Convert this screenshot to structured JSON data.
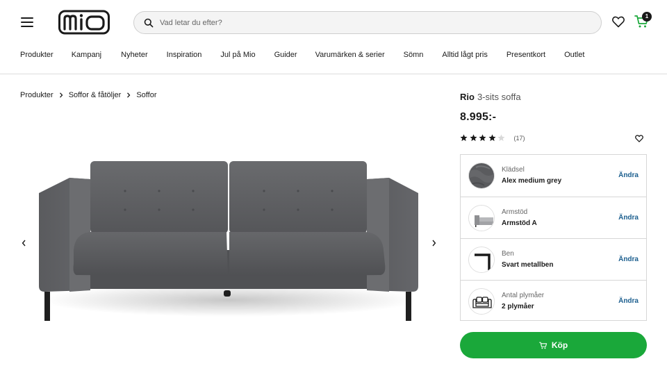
{
  "header": {
    "menu_icon": "hamburger-menu-icon",
    "logo_text": "mio",
    "search": {
      "placeholder": "Vad letar du efter?",
      "value": "",
      "icon": "search-icon"
    },
    "wishlist_icon": "heart-icon",
    "cart": {
      "icon": "cart-icon",
      "count": "1",
      "accent": "#1aa83a"
    }
  },
  "nav": {
    "items": [
      {
        "label": "Produkter"
      },
      {
        "label": "Kampanj"
      },
      {
        "label": "Nyheter"
      },
      {
        "label": "Inspiration"
      },
      {
        "label": "Jul på Mio"
      },
      {
        "label": "Guider"
      },
      {
        "label": "Varumärken & serier"
      },
      {
        "label": "Sömn"
      },
      {
        "label": "Alltid lågt pris"
      },
      {
        "label": "Presentkort"
      },
      {
        "label": "Outlet"
      }
    ]
  },
  "breadcrumb": {
    "items": [
      {
        "label": "Produkter"
      },
      {
        "label": "Soffor & fåtöljer"
      },
      {
        "label": "Soffor"
      }
    ]
  },
  "gallery": {
    "image": "grey-three-seat-sofa",
    "prev_icon": "chevron-left-icon",
    "next_icon": "chevron-right-icon",
    "sofa_color": "#5c5d60"
  },
  "product": {
    "name": "Rio",
    "subtitle": "3-sits soffa",
    "price": "8.995:-",
    "rating": {
      "stars": 4,
      "max": 5,
      "count_text": "(17)"
    },
    "favorite_icon": "heart-icon"
  },
  "options": [
    {
      "label": "Klädsel",
      "value": "Alex medium grey",
      "action": "Ändra",
      "thumb": "fabric-swatch"
    },
    {
      "label": "Armstöd",
      "value": "Armstöd A",
      "action": "Ändra",
      "thumb": "armrest-thumbnail"
    },
    {
      "label": "Ben",
      "value": "Svart metallben",
      "action": "Ändra",
      "thumb": "leg-thumbnail"
    },
    {
      "label": "Antal plymåer",
      "value": "2 plymåer",
      "action": "Ändra",
      "thumb": "cushion-sofa-icon"
    }
  ],
  "buy_button": {
    "label": "Köp",
    "icon": "cart-icon",
    "color": "#1aa83a"
  },
  "colors": {
    "link": "#1b5e8e",
    "border": "#d6d6d6",
    "text": "#1a1a1a"
  }
}
